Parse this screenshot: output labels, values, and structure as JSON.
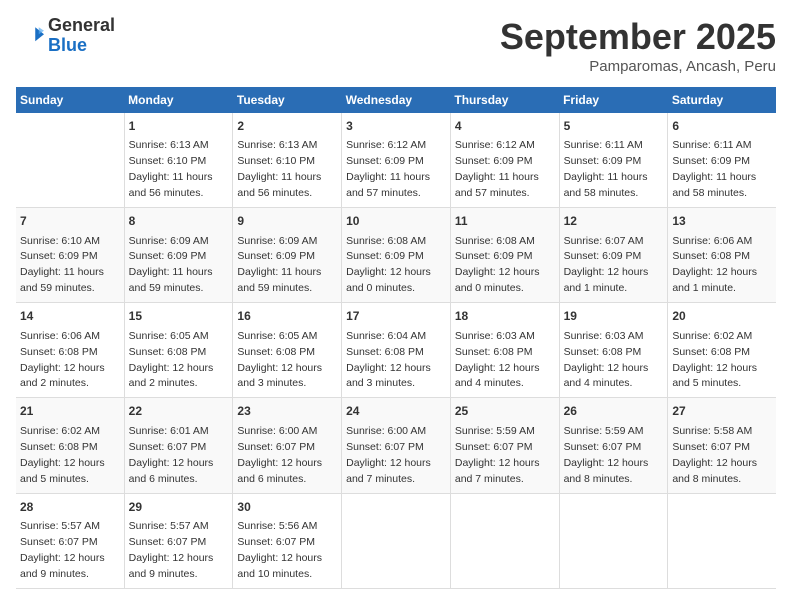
{
  "logo": {
    "general": "General",
    "blue": "Blue"
  },
  "title": "September 2025",
  "location": "Pamparomas, Ancash, Peru",
  "header_days": [
    "Sunday",
    "Monday",
    "Tuesday",
    "Wednesday",
    "Thursday",
    "Friday",
    "Saturday"
  ],
  "weeks": [
    [
      {
        "day": "",
        "info": ""
      },
      {
        "day": "1",
        "info": "Sunrise: 6:13 AM\nSunset: 6:10 PM\nDaylight: 11 hours\nand 56 minutes."
      },
      {
        "day": "2",
        "info": "Sunrise: 6:13 AM\nSunset: 6:10 PM\nDaylight: 11 hours\nand 56 minutes."
      },
      {
        "day": "3",
        "info": "Sunrise: 6:12 AM\nSunset: 6:09 PM\nDaylight: 11 hours\nand 57 minutes."
      },
      {
        "day": "4",
        "info": "Sunrise: 6:12 AM\nSunset: 6:09 PM\nDaylight: 11 hours\nand 57 minutes."
      },
      {
        "day": "5",
        "info": "Sunrise: 6:11 AM\nSunset: 6:09 PM\nDaylight: 11 hours\nand 58 minutes."
      },
      {
        "day": "6",
        "info": "Sunrise: 6:11 AM\nSunset: 6:09 PM\nDaylight: 11 hours\nand 58 minutes."
      }
    ],
    [
      {
        "day": "7",
        "info": "Sunrise: 6:10 AM\nSunset: 6:09 PM\nDaylight: 11 hours\nand 59 minutes."
      },
      {
        "day": "8",
        "info": "Sunrise: 6:09 AM\nSunset: 6:09 PM\nDaylight: 11 hours\nand 59 minutes."
      },
      {
        "day": "9",
        "info": "Sunrise: 6:09 AM\nSunset: 6:09 PM\nDaylight: 11 hours\nand 59 minutes."
      },
      {
        "day": "10",
        "info": "Sunrise: 6:08 AM\nSunset: 6:09 PM\nDaylight: 12 hours\nand 0 minutes."
      },
      {
        "day": "11",
        "info": "Sunrise: 6:08 AM\nSunset: 6:09 PM\nDaylight: 12 hours\nand 0 minutes."
      },
      {
        "day": "12",
        "info": "Sunrise: 6:07 AM\nSunset: 6:09 PM\nDaylight: 12 hours\nand 1 minute."
      },
      {
        "day": "13",
        "info": "Sunrise: 6:06 AM\nSunset: 6:08 PM\nDaylight: 12 hours\nand 1 minute."
      }
    ],
    [
      {
        "day": "14",
        "info": "Sunrise: 6:06 AM\nSunset: 6:08 PM\nDaylight: 12 hours\nand 2 minutes."
      },
      {
        "day": "15",
        "info": "Sunrise: 6:05 AM\nSunset: 6:08 PM\nDaylight: 12 hours\nand 2 minutes."
      },
      {
        "day": "16",
        "info": "Sunrise: 6:05 AM\nSunset: 6:08 PM\nDaylight: 12 hours\nand 3 minutes."
      },
      {
        "day": "17",
        "info": "Sunrise: 6:04 AM\nSunset: 6:08 PM\nDaylight: 12 hours\nand 3 minutes."
      },
      {
        "day": "18",
        "info": "Sunrise: 6:03 AM\nSunset: 6:08 PM\nDaylight: 12 hours\nand 4 minutes."
      },
      {
        "day": "19",
        "info": "Sunrise: 6:03 AM\nSunset: 6:08 PM\nDaylight: 12 hours\nand 4 minutes."
      },
      {
        "day": "20",
        "info": "Sunrise: 6:02 AM\nSunset: 6:08 PM\nDaylight: 12 hours\nand 5 minutes."
      }
    ],
    [
      {
        "day": "21",
        "info": "Sunrise: 6:02 AM\nSunset: 6:08 PM\nDaylight: 12 hours\nand 5 minutes."
      },
      {
        "day": "22",
        "info": "Sunrise: 6:01 AM\nSunset: 6:07 PM\nDaylight: 12 hours\nand 6 minutes."
      },
      {
        "day": "23",
        "info": "Sunrise: 6:00 AM\nSunset: 6:07 PM\nDaylight: 12 hours\nand 6 minutes."
      },
      {
        "day": "24",
        "info": "Sunrise: 6:00 AM\nSunset: 6:07 PM\nDaylight: 12 hours\nand 7 minutes."
      },
      {
        "day": "25",
        "info": "Sunrise: 5:59 AM\nSunset: 6:07 PM\nDaylight: 12 hours\nand 7 minutes."
      },
      {
        "day": "26",
        "info": "Sunrise: 5:59 AM\nSunset: 6:07 PM\nDaylight: 12 hours\nand 8 minutes."
      },
      {
        "day": "27",
        "info": "Sunrise: 5:58 AM\nSunset: 6:07 PM\nDaylight: 12 hours\nand 8 minutes."
      }
    ],
    [
      {
        "day": "28",
        "info": "Sunrise: 5:57 AM\nSunset: 6:07 PM\nDaylight: 12 hours\nand 9 minutes."
      },
      {
        "day": "29",
        "info": "Sunrise: 5:57 AM\nSunset: 6:07 PM\nDaylight: 12 hours\nand 9 minutes."
      },
      {
        "day": "30",
        "info": "Sunrise: 5:56 AM\nSunset: 6:07 PM\nDaylight: 12 hours\nand 10 minutes."
      },
      {
        "day": "",
        "info": ""
      },
      {
        "day": "",
        "info": ""
      },
      {
        "day": "",
        "info": ""
      },
      {
        "day": "",
        "info": ""
      }
    ]
  ]
}
